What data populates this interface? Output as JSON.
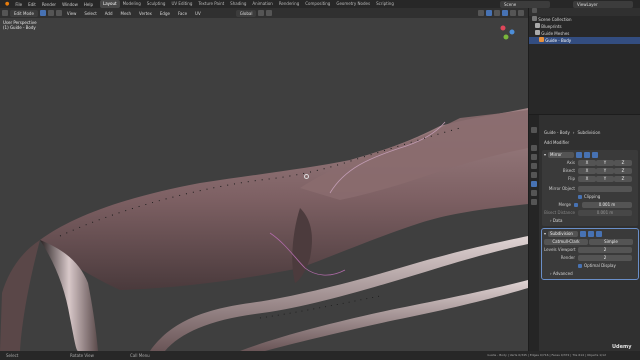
{
  "menu": {
    "items": [
      "File",
      "Edit",
      "Render",
      "Window",
      "Help"
    ]
  },
  "workspaces": {
    "tabs": [
      "Layout",
      "Modeling",
      "Sculpting",
      "UV Editing",
      "Texture Paint",
      "Shading",
      "Animation",
      "Rendering",
      "Compositing",
      "Geometry Nodes",
      "Scripting"
    ],
    "active": "Layout"
  },
  "top_right": {
    "scene": "Scene",
    "view_layer": "ViewLayer"
  },
  "viewport_header": {
    "mode": "Edit Mode",
    "menus": [
      "View",
      "Select",
      "Add",
      "Mesh",
      "Vertex",
      "Edge",
      "Face",
      "UV"
    ],
    "transform": "Global"
  },
  "viewport": {
    "perspective": "User Perspective",
    "object": "(1) Guide - Body"
  },
  "outliner": {
    "items": [
      "Scene Collection",
      "Blueprints",
      "Guide Meshes",
      "Guide - Body"
    ]
  },
  "properties": {
    "breadcrumb_object": "Guide - Body",
    "breadcrumb_modifier": "Subdivision",
    "add_modifier": "Add Modifier",
    "mirror": {
      "name": "Mirror",
      "axis_label": "Axis",
      "bisect_label": "Bisect",
      "flip_label": "Flip",
      "axes": [
        "X",
        "Y",
        "Z"
      ],
      "mirror_object_label": "Mirror Object",
      "clipping_label": "Clipping",
      "merge_label": "Merge",
      "merge_value": "0.001 m",
      "bisect_distance_label": "Bisect Distance",
      "bisect_distance_value": "0.001 m",
      "data_label": "Data"
    },
    "subdivision": {
      "name": "Subdivision",
      "catmull_label": "Catmull-Clark",
      "simple_label": "Simple",
      "levels_viewport_label": "Levels Viewport",
      "levels_viewport": "2",
      "render_label": "Render",
      "render": "2",
      "optimal_label": "Optimal Display",
      "advanced_label": "Advanced"
    }
  },
  "status": {
    "select": "Select",
    "rotate": "Rotate View",
    "menu": "Call Menu",
    "stats": "Guide - Body | Verts 0/345 | Edges 0/716 | Faces 0/372 | Tris 614 | Objects 1/12"
  },
  "watermark": "Udemy",
  "colors": {
    "accent": "#4772b3",
    "surface": "#8a6c6e",
    "highlight": "#c09bb2"
  }
}
